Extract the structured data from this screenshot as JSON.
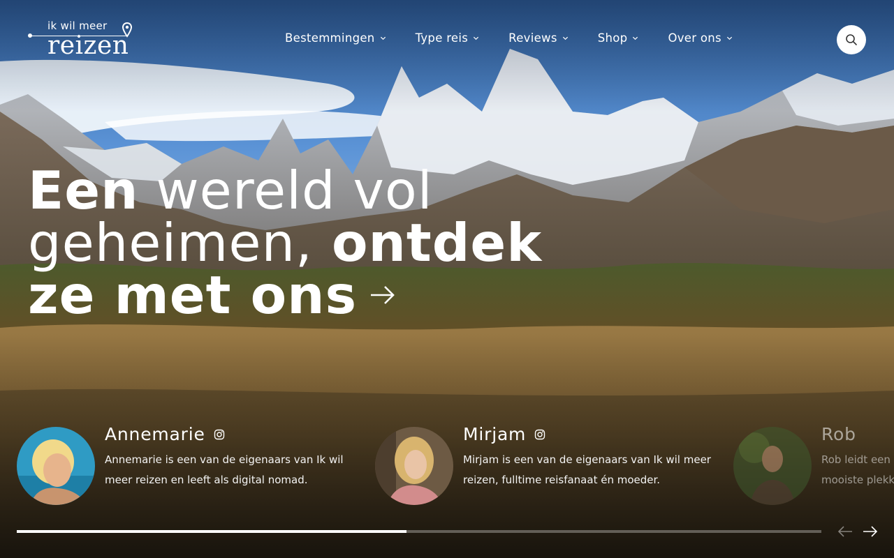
{
  "logo": {
    "small": "ik wil meer",
    "big": "reizen"
  },
  "nav": [
    {
      "label": "Bestemmingen"
    },
    {
      "label": "Type reis"
    },
    {
      "label": "Reviews"
    },
    {
      "label": "Shop"
    },
    {
      "label": "Over ons"
    }
  ],
  "headline": {
    "part1": "Een",
    "part2": " wereld vol geheimen,",
    "part3": " ontdek ze met ons"
  },
  "team": [
    {
      "name": "Annemarie",
      "bio": "Annemarie is een van de eigenaars van Ik wil meer reizen en leeft als digital nomad."
    },
    {
      "name": "Mirjam",
      "bio": "Mirjam is een van de eigenaars van Ik wil meer reizen, fulltime reisfanaat én moeder."
    },
    {
      "name": "Rob",
      "bio": "Rob leidt een r mooiste plekk"
    }
  ],
  "carousel": {
    "progress_fraction": 0.484
  },
  "colors": {
    "sky": "#5b93d6",
    "snow": "#eef3f8",
    "grass": "#8a6a3a",
    "forest": "#3d4a26"
  },
  "icons": {
    "search": "search-icon",
    "instagram": "instagram-icon",
    "prev": "arrow-left-icon",
    "next": "arrow-right-icon"
  }
}
